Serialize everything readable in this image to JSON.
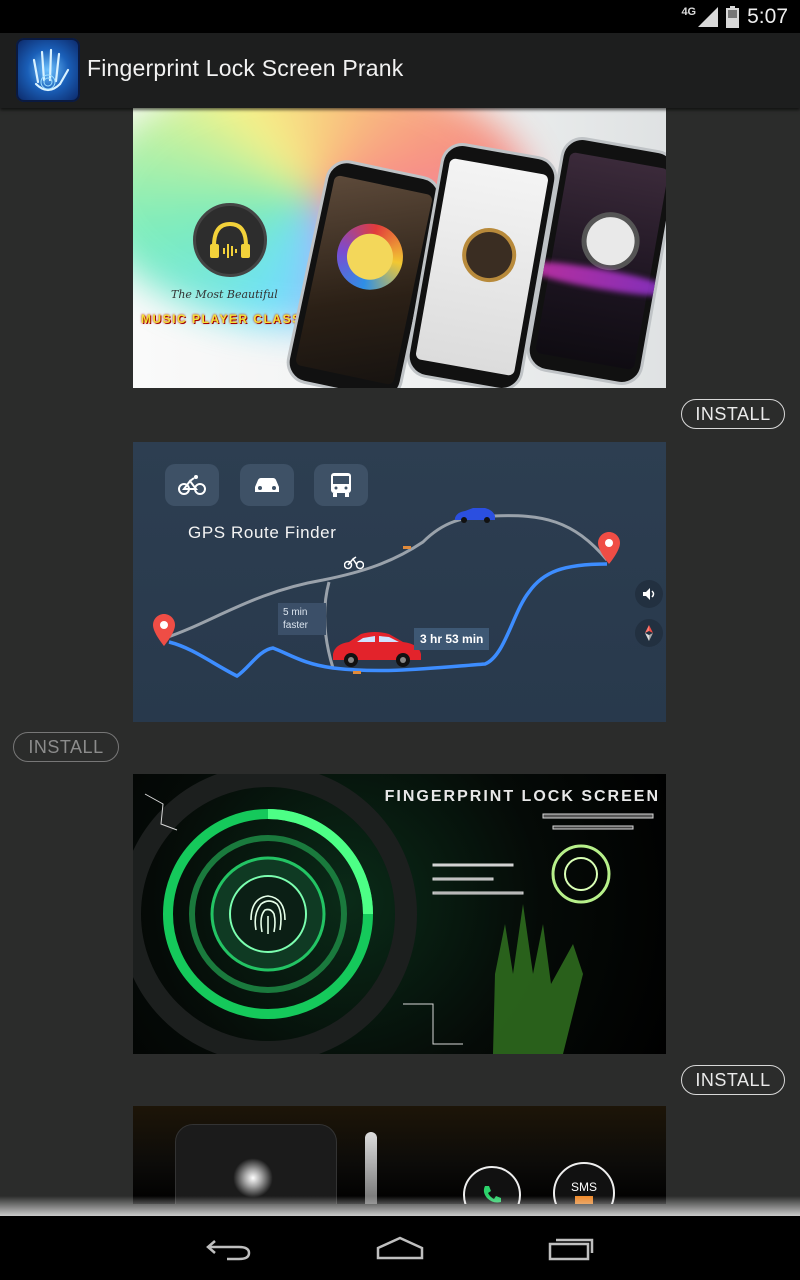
{
  "status_bar": {
    "network": "4G",
    "time": "5:07"
  },
  "app_bar": {
    "title": "Fingerprint Lock Screen Prank",
    "icon": "fingerprint-hand-icon"
  },
  "feed": {
    "items": [
      {
        "tagline": "The Most Beautiful",
        "brand": "MUSIC PLAYER CLASSIC",
        "install_label": "INSTALL"
      },
      {
        "title": "GPS Route Finder",
        "chip": "5 min faster",
        "eta": "3 hr 53 min",
        "install_label": "INSTALL"
      },
      {
        "title": "FINGERPRINT LOCK SCREEN",
        "install_label": "INSTALL"
      },
      {
        "badge": "SMS"
      }
    ]
  },
  "nav_bar": {
    "back": "back-icon",
    "home": "home-icon",
    "recents": "recents-icon"
  }
}
